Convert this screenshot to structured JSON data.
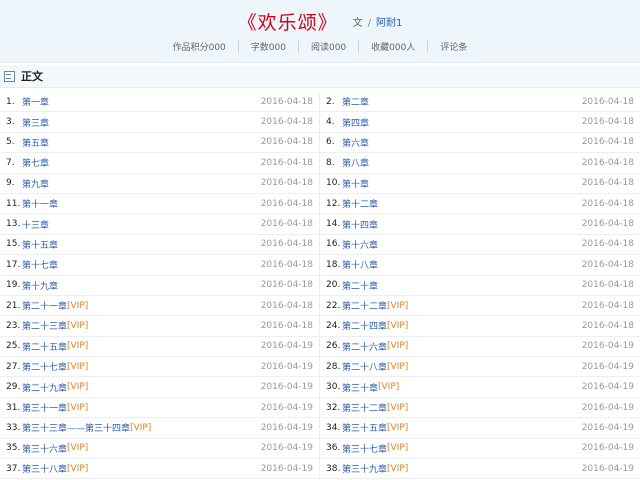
{
  "book": {
    "title": "《欢乐颂》",
    "type_label": "文",
    "sep": "/",
    "author": "阿耐1"
  },
  "stats": [
    "作品积分000",
    "字数000",
    "阅读000",
    "收藏000人",
    "评论条"
  ],
  "section_title": "正文",
  "colors": {
    "title_red": "#d0021b",
    "link_blue": "#2a5db0",
    "vip_orange": "#e67e22",
    "date_gray": "#999999"
  },
  "chapters": [
    {
      "num": "1.",
      "name": "第一章",
      "vip": "",
      "date": "2016-04-18"
    },
    {
      "num": "2.",
      "name": "第二章",
      "vip": "",
      "date": "2016-04-18"
    },
    {
      "num": "3.",
      "name": "第三章",
      "vip": "",
      "date": "2016-04-18"
    },
    {
      "num": "4.",
      "name": "第四章",
      "vip": "",
      "date": "2016-04-18"
    },
    {
      "num": "5.",
      "name": "第五章",
      "vip": "",
      "date": "2016-04-18"
    },
    {
      "num": "6.",
      "name": "第六章",
      "vip": "",
      "date": "2016-04-18"
    },
    {
      "num": "7.",
      "name": "第七章",
      "vip": "",
      "date": "2016-04-18"
    },
    {
      "num": "8.",
      "name": "第八章",
      "vip": "",
      "date": "2016-04-18"
    },
    {
      "num": "9.",
      "name": "第九章",
      "vip": "",
      "date": "2016-04-18"
    },
    {
      "num": "10.",
      "name": "第十章",
      "vip": "",
      "date": "2016-04-18"
    },
    {
      "num": "11.",
      "name": "第十一章",
      "vip": "",
      "date": "2016-04-18"
    },
    {
      "num": "12.",
      "name": "第十二章",
      "vip": "",
      "date": "2016-04-18"
    },
    {
      "num": "13.",
      "name": "十三章",
      "vip": "",
      "date": "2016-04-18"
    },
    {
      "num": "14.",
      "name": "第十四章",
      "vip": "",
      "date": "2016-04-18"
    },
    {
      "num": "15.",
      "name": "第十五章",
      "vip": "",
      "date": "2016-04-18"
    },
    {
      "num": "16.",
      "name": "第十六章",
      "vip": "",
      "date": "2016-04-18"
    },
    {
      "num": "17.",
      "name": "第十七章",
      "vip": "",
      "date": "2016-04-18"
    },
    {
      "num": "18.",
      "name": "第十八章",
      "vip": "",
      "date": "2016-04-18"
    },
    {
      "num": "19.",
      "name": "第十九章",
      "vip": "",
      "date": "2016-04-18"
    },
    {
      "num": "20.",
      "name": "第二十章",
      "vip": "",
      "date": "2016-04-18"
    },
    {
      "num": "21.",
      "name": "第二十一章",
      "vip": "[VIP]",
      "date": "2016-04-18"
    },
    {
      "num": "22.",
      "name": "第二十二章",
      "vip": "[VIP]",
      "date": "2016-04-18"
    },
    {
      "num": "23.",
      "name": "第二十三章",
      "vip": "[VIP]",
      "date": "2016-04-18"
    },
    {
      "num": "24.",
      "name": "第二十四章",
      "vip": "[VIP]",
      "date": "2016-04-18"
    },
    {
      "num": "25.",
      "name": "第二十五章",
      "vip": "[VIP]",
      "date": "2016-04-19"
    },
    {
      "num": "26.",
      "name": "第二十六章",
      "vip": "[VIP]",
      "date": "2016-04-19"
    },
    {
      "num": "27.",
      "name": "第二十七章",
      "vip": "[VIP]",
      "date": "2016-04-19"
    },
    {
      "num": "28.",
      "name": "第二十八章",
      "vip": "[VIP]",
      "date": "2016-04-19"
    },
    {
      "num": "29.",
      "name": "第二十九章",
      "vip": "[VIP]",
      "date": "2016-04-19"
    },
    {
      "num": "30.",
      "name": "第三十章",
      "vip": "[VIP]",
      "date": "2016-04-19"
    },
    {
      "num": "31.",
      "name": "第三十一章",
      "vip": "[VIP]",
      "date": "2016-04-19"
    },
    {
      "num": "32.",
      "name": "第三十二章",
      "vip": "[VIP]",
      "date": "2016-04-19"
    },
    {
      "num": "33.",
      "name": "第三十三章——第三十四章",
      "vip": "[VIP]",
      "date": "2016-04-19"
    },
    {
      "num": "34.",
      "name": "第三十五章",
      "vip": "[VIP]",
      "date": "2016-04-19"
    },
    {
      "num": "35.",
      "name": "第三十六章",
      "vip": "[VIP]",
      "date": "2016-04-19"
    },
    {
      "num": "36.",
      "name": "第三十七章",
      "vip": "[VIP]",
      "date": "2016-04-19"
    },
    {
      "num": "37.",
      "name": "第三十八章",
      "vip": "[VIP]",
      "date": "2016-04-19"
    },
    {
      "num": "38.",
      "name": "第三十九章",
      "vip": "[VIP]",
      "date": "2016-04-19"
    }
  ]
}
